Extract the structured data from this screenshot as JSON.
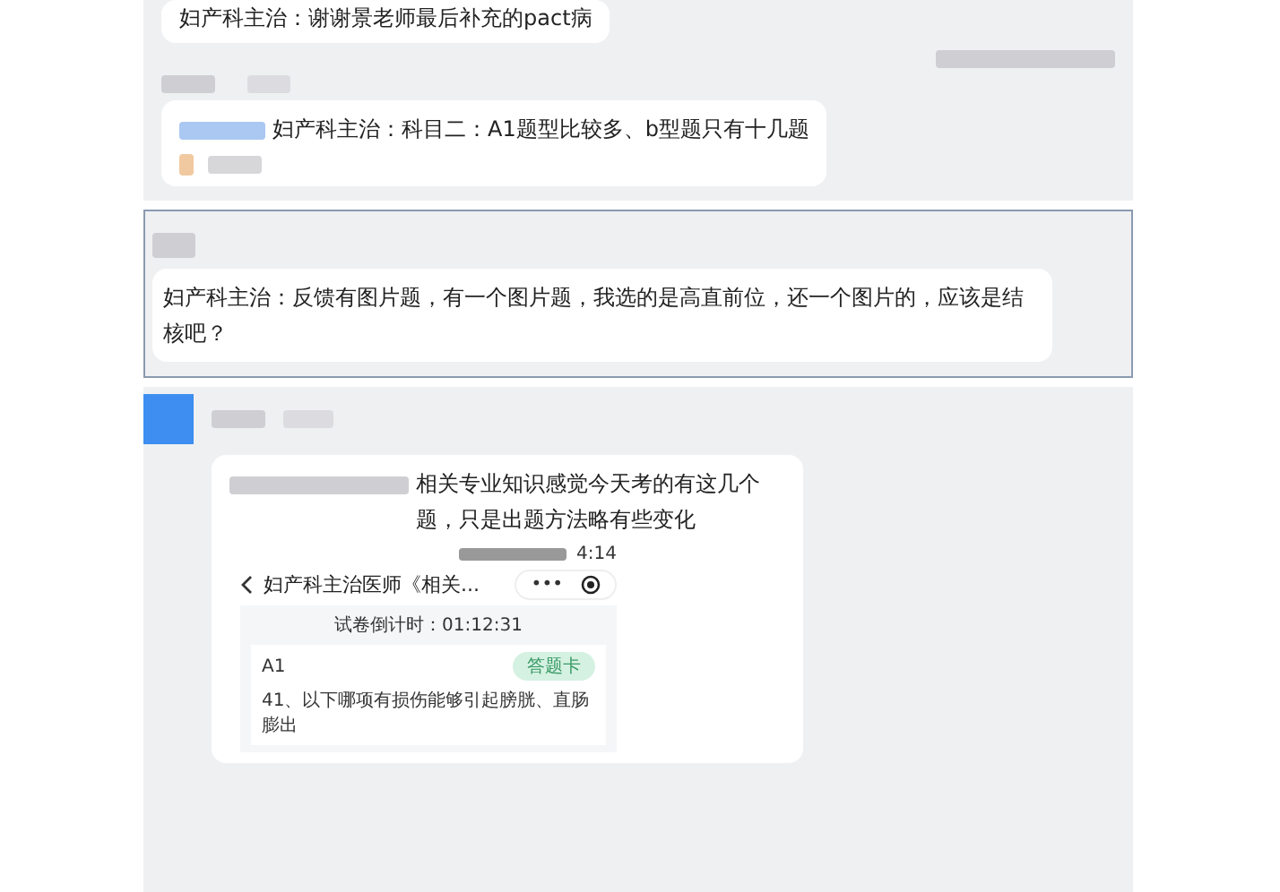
{
  "top_message": {
    "text": "妇产科主治：谢谢景老师最后补充的pact病"
  },
  "messages": [
    {
      "kind": "mention",
      "text": "妇产科主治：科目二：A1题型比较多、b型题只有十几题"
    },
    {
      "kind": "plain",
      "text": "妇产科主治：反馈有图片题，有一个图片题，我选的是高直前位，还一个图片的，应该是结核吧？"
    }
  ],
  "last_message": {
    "text": "相关专业知识感觉今天考的有这几个题，只是出题方法略有些变化",
    "phone": {
      "time": "4:14",
      "title": "妇产科主治医师《相关...",
      "more": "•••",
      "timer": "试卷倒计时：01:12:31",
      "section": "A1",
      "card_button": "答题卡",
      "question": "41、以下哪项有损伤能够引起膀胱、直肠膨出"
    }
  }
}
